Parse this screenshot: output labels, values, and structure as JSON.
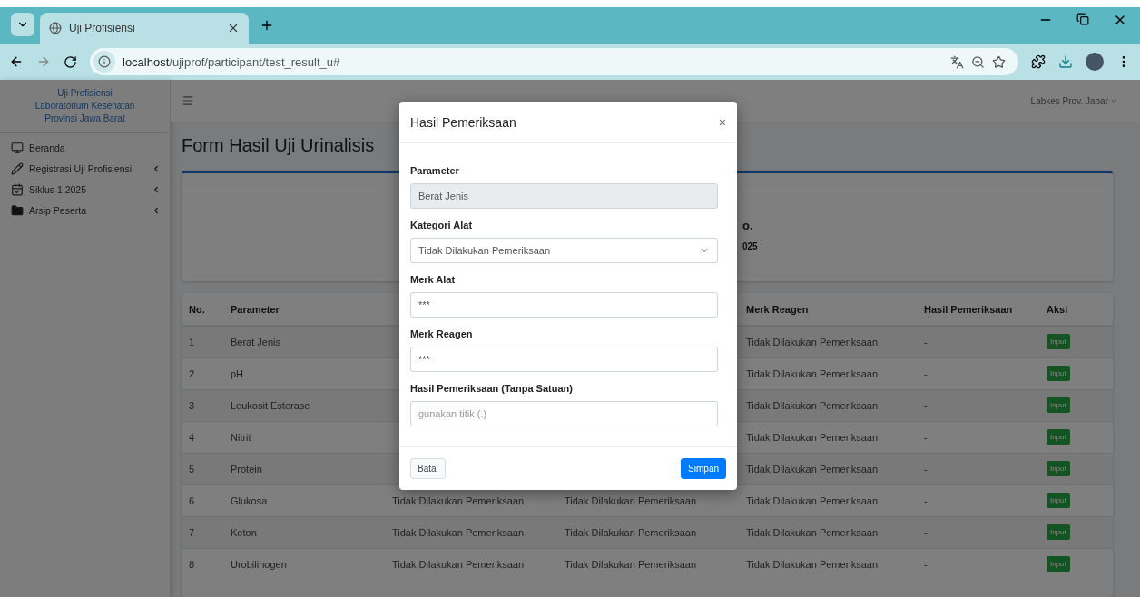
{
  "browser": {
    "tab_title": "Uji Profisiensi",
    "url": "**localhost**/ujiprof/participant/test_result_u#"
  },
  "sidebar": {
    "brand_lines": [
      "Uji Profisiensi",
      "Laboratorium Kesehatan",
      "Provinsi Jawa Barat"
    ],
    "items": [
      {
        "kind": "monitor",
        "label": "Beranda",
        "has_submenu": false
      },
      {
        "kind": "pen",
        "label": "Registrasi Uji Profisiensi",
        "has_submenu": true
      },
      {
        "kind": "calendar",
        "label": "Siklus 1 2025",
        "has_submenu": true
      },
      {
        "kind": "folder",
        "label": "Arsip Peserta",
        "has_submenu": true
      }
    ]
  },
  "header": {
    "user": "Labkes Prov. Jabar"
  },
  "page_title": "Form Hasil Uji Urinalisis",
  "info_card": {
    "line_1": "o.",
    "line_2": "025"
  },
  "table": {
    "columns": [
      "No.",
      "Parameter",
      null,
      null,
      "Merk Reagen",
      "Hasil Pemeriksaan",
      "Aksi"
    ],
    "rows": [
      {
        "no": "1",
        "parameter": "Berat Jenis",
        "merk_reagen": "Tidak Dilakukan Pemeriksaan",
        "hasil": "-",
        "action": "Input"
      },
      {
        "no": "2",
        "parameter": "pH",
        "merk_reagen": "Tidak Dilakukan Pemeriksaan",
        "hasil": "-",
        "action": "Input"
      },
      {
        "no": "3",
        "parameter": "Leukosit Esterase",
        "merk_reagen": "Tidak Dilakukan Pemeriksaan",
        "hasil": "-",
        "action": "Input"
      },
      {
        "no": "4",
        "parameter": "Nitrit",
        "merk_reagen": "Tidak Dilakukan Pemeriksaan",
        "hasil": "-",
        "action": "Input"
      },
      {
        "no": "5",
        "parameter": "Protein",
        "merk_reagen": "Tidak Dilakukan Pemeriksaan",
        "hasil": "-",
        "action": "Input"
      },
      {
        "no": "6",
        "parameter": "Glukosa",
        "column_3": "Tidak Dilakukan Pemeriksaan",
        "column_4": "Tidak Dilakukan Pemeriksaan",
        "merk_reagen": "Tidak Dilakukan Pemeriksaan",
        "hasil": "-",
        "action": "Input"
      },
      {
        "no": "7",
        "parameter": "Keton",
        "column_3": "Tidak Dilakukan Pemeriksaan",
        "column_4": "Tidak Dilakukan Pemeriksaan",
        "merk_reagen": "Tidak Dilakukan Pemeriksaan",
        "hasil": "-",
        "action": "Input"
      },
      {
        "no": "8",
        "parameter": "Urobilinogen",
        "column_3": "Tidak Dilakukan Pemeriksaan",
        "column_4": "Tidak Dilakukan Pemeriksaan",
        "merk_reagen": "Tidak Dilakukan Pemeriksaan",
        "hasil": "-",
        "action": "Input"
      }
    ]
  },
  "modal": {
    "title": "Hasil Pemeriksaan",
    "close": "×",
    "fields": [
      {
        "kind": "readonly",
        "label": "Parameter",
        "value": "Berat Jenis"
      },
      {
        "kind": "select",
        "label": "Kategori Alat",
        "value": "Tidak Dilakukan Pemeriksaan"
      },
      {
        "kind": "text",
        "label": "Merk Alat",
        "value": "***"
      },
      {
        "kind": "text",
        "label": "Merk Reagen",
        "value": "***"
      },
      {
        "kind": "text",
        "label": "Hasil Pemeriksaan (Tanpa Satuan)",
        "placeholder": "gunakan titik (.)"
      }
    ],
    "cancel": "Batal",
    "save": "Simpan"
  }
}
